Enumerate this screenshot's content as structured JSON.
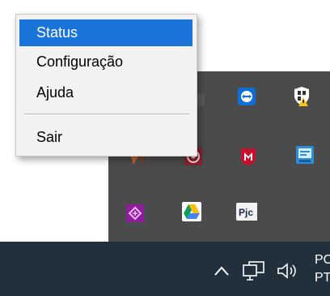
{
  "context_menu": {
    "items": [
      {
        "label": "Status",
        "highlighted": true
      },
      {
        "label": "Configuração",
        "highlighted": false
      },
      {
        "label": "Ajuda",
        "highlighted": false
      },
      {
        "label": "Sair",
        "highlighted": false
      }
    ],
    "highlight_color": "#1a73d9"
  },
  "tray_flyout": {
    "background": "#4b4b4b",
    "icons": [
      {
        "name": "hidden-app-icon"
      },
      {
        "name": "teamviewer-icon"
      },
      {
        "name": "windows-security-warning-icon"
      },
      {
        "name": "orange-app-icon"
      },
      {
        "name": "red-circle-app-icon"
      },
      {
        "name": "mcafee-icon"
      },
      {
        "name": "blue-app-icon"
      },
      {
        "name": "purple-app-icon"
      },
      {
        "name": "google-drive-icon"
      },
      {
        "name": "pjc-app-icon"
      }
    ],
    "pjc_label": "Pjc"
  },
  "taskbar": {
    "background": "#22303e",
    "lang_line1": "PO",
    "lang_line2": "PT"
  }
}
